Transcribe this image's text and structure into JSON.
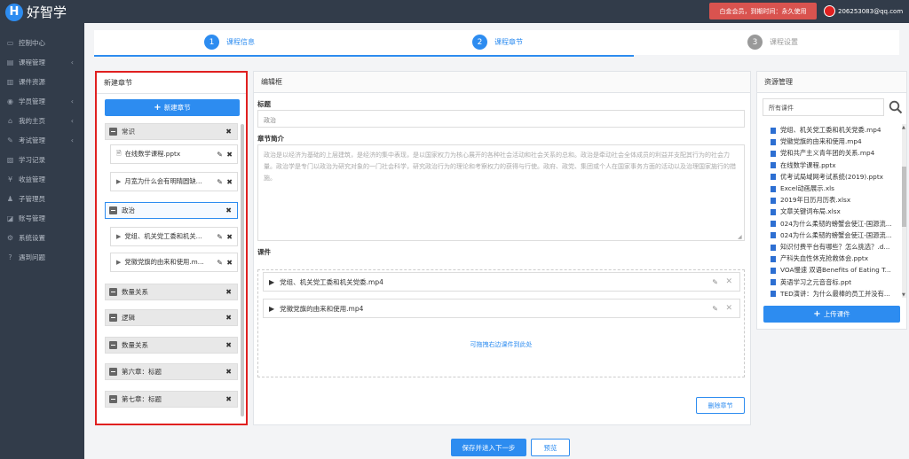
{
  "header": {
    "logo_letter": "H",
    "logo_text": "好智学",
    "vip_badge": "白金会员，到期时间：永久使用",
    "user_email": "206253083@qq.com"
  },
  "sidebar": {
    "items": [
      {
        "label": "控制中心",
        "icon": "monitor-icon",
        "arrow": false
      },
      {
        "label": "课程管理",
        "icon": "book-icon",
        "arrow": true
      },
      {
        "label": "课件资源",
        "icon": "folder-icon",
        "arrow": false
      },
      {
        "label": "学员管理",
        "icon": "users-icon",
        "arrow": true
      },
      {
        "label": "我的主页",
        "icon": "home-icon",
        "arrow": true
      },
      {
        "label": "考试管理",
        "icon": "exam-icon",
        "arrow": true
      },
      {
        "label": "学习记录",
        "icon": "record-icon",
        "arrow": false
      },
      {
        "label": "收益管理",
        "icon": "money-icon",
        "arrow": false
      },
      {
        "label": "子管理员",
        "icon": "admin-icon",
        "arrow": false
      },
      {
        "label": "账号管理",
        "icon": "account-icon",
        "arrow": false
      },
      {
        "label": "系统设置",
        "icon": "gear-icon",
        "arrow": false
      },
      {
        "label": "遇到问题",
        "icon": "help-icon",
        "arrow": false
      }
    ]
  },
  "steps": [
    {
      "num": "1",
      "label": "课程信息",
      "state": "done"
    },
    {
      "num": "2",
      "label": "课程章节",
      "state": "active"
    },
    {
      "num": "3",
      "label": "课程设置",
      "state": "pending"
    }
  ],
  "chapters": {
    "title": "新建章节",
    "new_button": "新建章节",
    "rows": [
      {
        "type": "chapter",
        "label": "常识"
      },
      {
        "type": "lesson",
        "label": "在线数学课程.pptx",
        "icon": "file"
      },
      {
        "type": "lesson",
        "label": "月宽为什么会有明晴圆缺...",
        "icon": "play"
      },
      {
        "type": "chapter",
        "label": "政治",
        "selected": true
      },
      {
        "type": "lesson",
        "label": "党组、机关党工委和机关...",
        "icon": "play"
      },
      {
        "type": "lesson",
        "label": "党徽党旗的由来和使用.m...",
        "icon": "play"
      },
      {
        "type": "chapter",
        "label": "数量关系"
      },
      {
        "type": "chapter",
        "label": "逻辑"
      },
      {
        "type": "chapter",
        "label": "数量关系"
      },
      {
        "type": "chapter",
        "label": "第六章：标题"
      },
      {
        "type": "chapter",
        "label": "第七章：标题"
      }
    ]
  },
  "editor": {
    "title": "编辑框",
    "title_label": "标题",
    "title_value": "政治",
    "intro_label": "章节简介",
    "intro_value": "政治是以经济为基础的上层建筑，是经济的集中表现，是以国家权力为核心展开的各种社会活动和社会关系的总和。政治是牵动社会全体成员的利益并支配其行为的社会力量。政治学是专门以政治为研究对象的一门社会科学，研究政治行为的理论和考察权力的获得与行使。政府、政党、集团或个人在国家事务方面的活动以及治理国家施行的措施。",
    "courseware_label": "课件",
    "courseware": [
      "党组、机关党工委和机关党委.mp4",
      "党徽党旗的由来和使用.mp4"
    ],
    "drop_hint": "可拖拽右边课件到此处",
    "delete_button": "删除章节"
  },
  "resources": {
    "title": "资源管理",
    "filter_value": "所有课件",
    "items": [
      "党组、机关党工委和机关党委.mp4",
      "党徽党旗的由来和使用.mp4",
      "党和共产主义青年团的关系.mp4",
      "在线数学课程.pptx",
      "优考试局域网考试系统(2019).pptx",
      "Excel动画展示.xls",
      "2019年日历月历表.xlsx",
      "文章关键词布局.xlsx",
      "024为什么柔韧的螃蟹会使江-国源流...",
      "024为什么柔韧的螃蟹会使江-国源流...",
      "知识付费平台有哪些？怎么挑选？.d...",
      "产科失血性休克抢救体会.pptx",
      "VOA慢速 双语Benefits of Eating T...",
      "英语学习之元音音标.ppt",
      "TED演讲：为什么最棒的员工并没有..."
    ],
    "upload_button": "上传课件"
  },
  "footer": {
    "next_button": "保存并进入下一步",
    "prev_button": "预览"
  }
}
